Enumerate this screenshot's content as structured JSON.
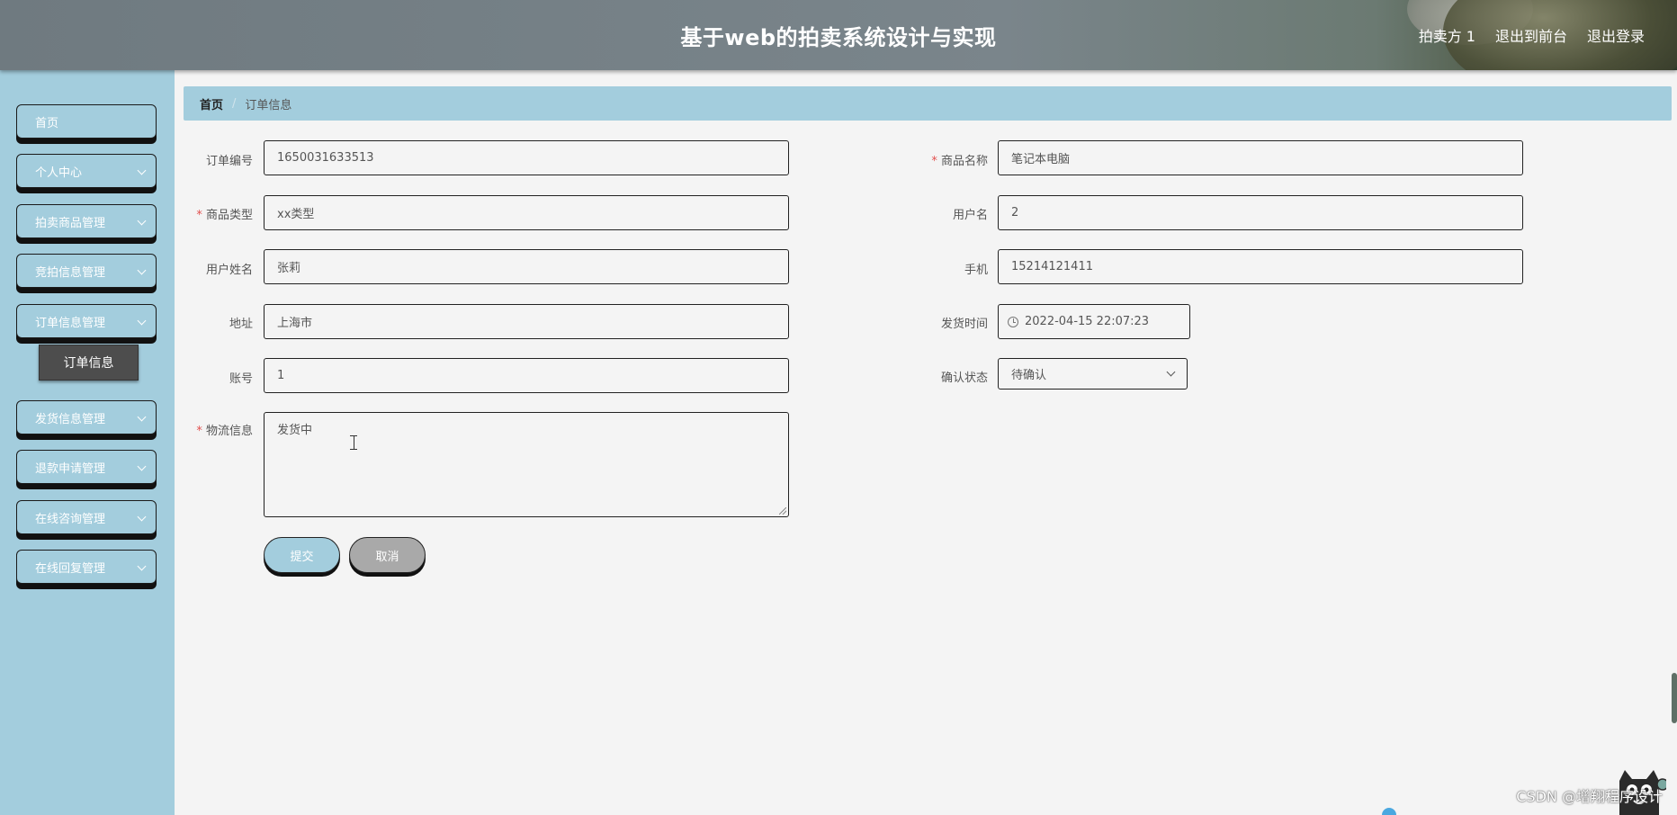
{
  "header": {
    "title": "基于web的拍卖系统设计与实现",
    "links": [
      "拍卖方 1",
      "退出到前台",
      "退出登录"
    ]
  },
  "sidebar": {
    "items": [
      {
        "label": "首页",
        "has_chevron": false
      },
      {
        "label": "个人中心",
        "has_chevron": true
      },
      {
        "label": "拍卖商品管理",
        "has_chevron": true
      },
      {
        "label": "竞拍信息管理",
        "has_chevron": true
      },
      {
        "label": "订单信息管理",
        "has_chevron": true
      },
      {
        "label": "发货信息管理",
        "has_chevron": true
      },
      {
        "label": "退款申请管理",
        "has_chevron": true
      },
      {
        "label": "在线咨询管理",
        "has_chevron": true
      },
      {
        "label": "在线回复管理",
        "has_chevron": true
      }
    ],
    "active_sub_item": "订单信息"
  },
  "breadcrumb": {
    "home": "首页",
    "separator": "/",
    "current": "订单信息"
  },
  "form": {
    "order_no": {
      "label": "订单编号",
      "value": "1650031633513"
    },
    "goods_name": {
      "label": "商品名称",
      "value": "笔记本电脑",
      "required": true
    },
    "goods_type": {
      "label": "商品类型",
      "value": "xx类型",
      "required": true
    },
    "username": {
      "label": "用户名",
      "value": "2"
    },
    "user_realname": {
      "label": "用户姓名",
      "value": "张莉"
    },
    "phone": {
      "label": "手机",
      "value": "15214121411"
    },
    "address": {
      "label": "地址",
      "value": "上海市"
    },
    "ship_time": {
      "label": "发货时间",
      "value": "2022-04-15 22:07:23"
    },
    "account": {
      "label": "账号",
      "value": "1"
    },
    "confirm_status": {
      "label": "确认状态",
      "value": "待确认"
    },
    "logistics": {
      "label": "物流信息",
      "value": "发货中",
      "required": true
    },
    "submit_label": "提交",
    "cancel_label": "取消"
  },
  "watermark": "CSDN @增翔程序设计",
  "colors": {
    "sidebar_bg": "#a3cddd",
    "header_bg": "#7a858b",
    "sub_item_bg": "#4d4d4d",
    "required_star": "#e2504f",
    "cancel_bg": "#a9a9a9"
  }
}
